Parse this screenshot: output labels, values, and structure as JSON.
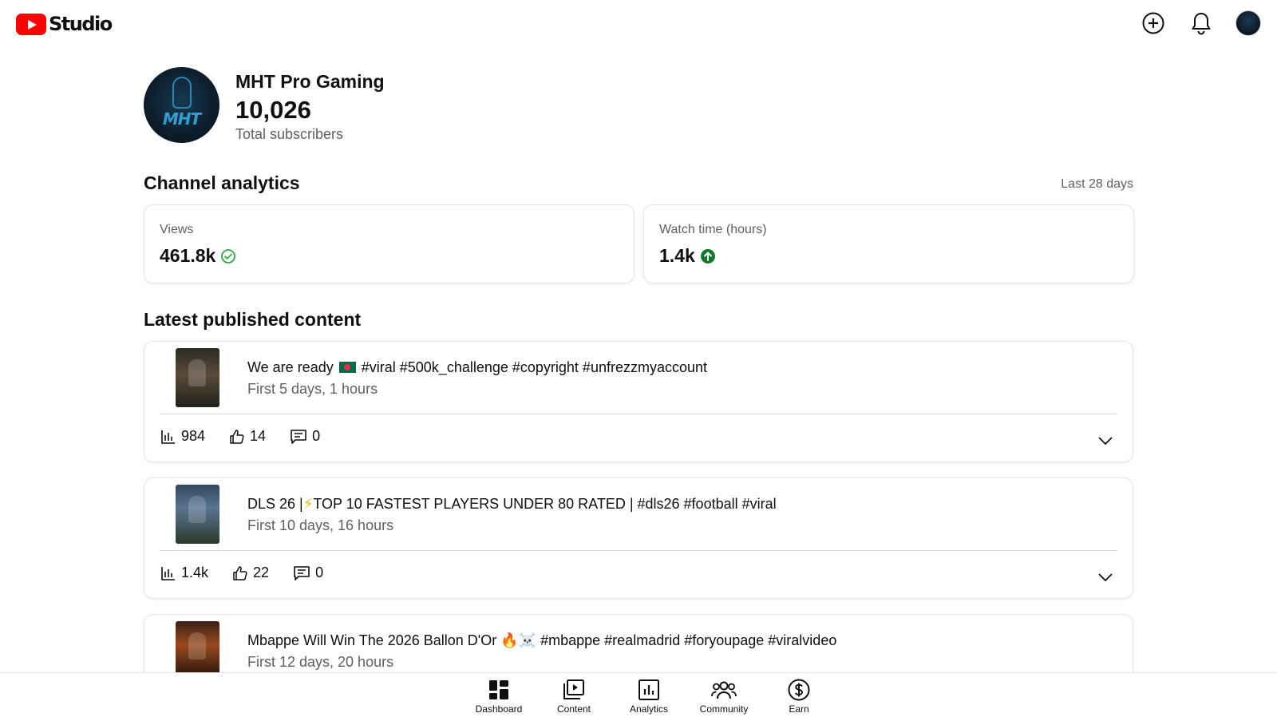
{
  "header": {
    "logo_text": "Studio",
    "icons": [
      "create-icon",
      "notifications-icon",
      "account-avatar"
    ]
  },
  "channel": {
    "name": "MHT Pro Gaming",
    "avatar_text": "MHT",
    "subscribers": "10,026",
    "subscribers_label": "Total subscribers"
  },
  "analytics": {
    "title": "Channel analytics",
    "period": "Last 28 days",
    "cards": [
      {
        "label": "Views",
        "value": "461.8k",
        "icon": "check-circle-icon"
      },
      {
        "label": "Watch time (hours)",
        "value": "1.4k",
        "icon": "arrow-up-circle-icon"
      }
    ]
  },
  "latest": {
    "title": "Latest published content",
    "items": [
      {
        "title_pre": "We are ready",
        "title_post": "#viral #500k_challenge #copyright #unfrezzmyaccount",
        "subtitle": "First 5 days, 1 hours",
        "views": "984",
        "likes": "14",
        "comments": "0"
      },
      {
        "title_pre": "DLS 26 |",
        "title_emoji": "⚡",
        "title_post": "TOP 10 FASTEST PLAYERS UNDER 80 RATED | #dls26 #football #viral",
        "subtitle": "First 10 days, 16 hours",
        "views": "1.4k",
        "likes": "22",
        "comments": "0"
      },
      {
        "title_pre": "Mbappe Will Win The 2026 Ballon D'Or",
        "title_emoji": "🔥☠️",
        "title_post": "#mbappe #realmadrid #foryoupage #viralvideo",
        "subtitle": "First 12 days, 20 hours"
      }
    ]
  },
  "bottom_nav": {
    "items": [
      {
        "label": "Dashboard",
        "icon": "dashboard-icon"
      },
      {
        "label": "Content",
        "icon": "content-icon"
      },
      {
        "label": "Analytics",
        "icon": "analytics-icon"
      },
      {
        "label": "Community",
        "icon": "community-icon"
      },
      {
        "label": "Earn",
        "icon": "earn-icon"
      }
    ]
  },
  "colors": {
    "brand_red": "#ff0000",
    "success_green": "#2ba640",
    "up_green": "#0f7a2a",
    "secondary_text": "#606060"
  }
}
